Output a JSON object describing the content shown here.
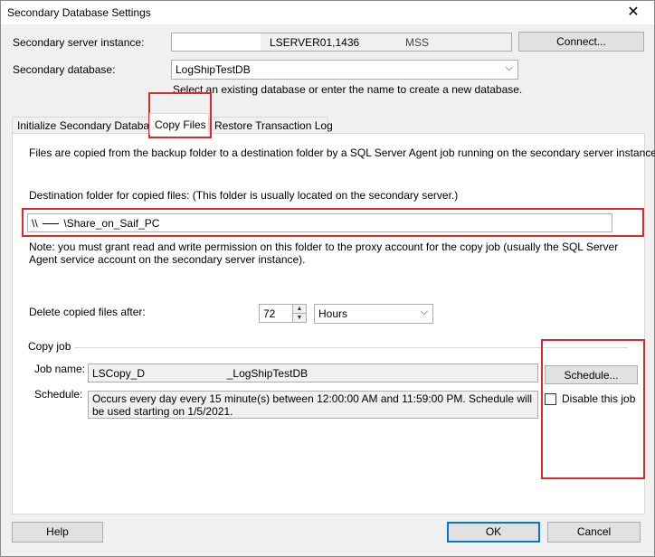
{
  "window": {
    "title": "Secondary Database Settings",
    "close_glyph": "✕"
  },
  "server": {
    "label": "Secondary server instance:",
    "value_hidden": "MSS",
    "value": "LSERVER01,1436",
    "connect_label": "Connect..."
  },
  "database": {
    "label": "Secondary database:",
    "value": "LogShipTestDB",
    "hint": "Select an existing database or enter the name to create a new database."
  },
  "tabs": [
    {
      "label": "Initialize Secondary Database"
    },
    {
      "label": "Copy Files"
    },
    {
      "label": "Restore Transaction Log"
    }
  ],
  "copy_files": {
    "intro": "Files are copied from the backup folder to a destination folder by a SQL Server Agent job running on the secondary server instance.",
    "dest_label": "Destination folder for copied files: (This folder is usually located on the secondary server.)",
    "dest_prefix": "\\\\",
    "dest_value": "\\Share_on_Saif_PC",
    "note": "Note: you must grant read and write permission on this folder to the proxy account for the copy job (usually the SQL Server Agent service account on the secondary server instance).",
    "delete_label": "Delete copied files after:",
    "delete_value": "72",
    "delete_unit": "Hours"
  },
  "copy_job": {
    "group_label": "Copy job",
    "job_name_label": "Job name:",
    "job_name_start": "LSCopy_D",
    "job_name_end": "_LogShipTestDB",
    "schedule_button": "Schedule...",
    "schedule_label": "Schedule:",
    "schedule_text": "Occurs every day every 15 minute(s) between 12:00:00 AM and 11:59:00 PM. Schedule will be used starting on 1/5/2021.",
    "disable_label": "Disable this job"
  },
  "footer": {
    "help": "Help",
    "ok": "OK",
    "cancel": "Cancel"
  },
  "colors": {
    "highlight": "#e0262e",
    "accent": "#0078d7"
  },
  "icons": {
    "spin_up": "▲",
    "spin_down": "▼",
    "dropdown": "⌵"
  }
}
